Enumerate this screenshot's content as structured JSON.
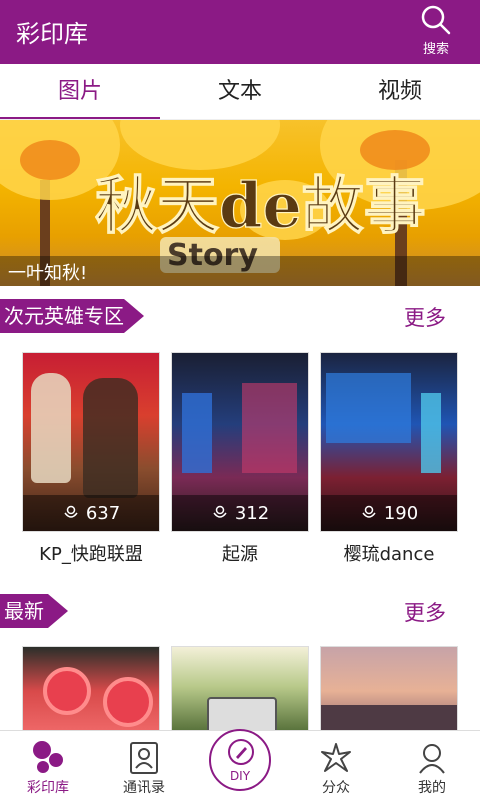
{
  "header": {
    "title": "彩印库",
    "search_label": "搜索"
  },
  "tabs": [
    {
      "label": "图片",
      "active": true
    },
    {
      "label": "文本",
      "active": false
    },
    {
      "label": "视频",
      "active": false
    }
  ],
  "banner": {
    "caption": "一叶知秋!",
    "art_text_main": "秋天de故事",
    "art_text_sub": "Story"
  },
  "section_hot": {
    "title": "次元英雄专区",
    "more": "更多",
    "items": [
      {
        "name": "KP_快跑联盟",
        "count": "637"
      },
      {
        "name": "起源",
        "count": "312"
      },
      {
        "name": "樱琉dance",
        "count": "190"
      }
    ]
  },
  "section_new": {
    "title": "最新",
    "more": "更多"
  },
  "bottom_nav": [
    {
      "label": "彩印库",
      "icon": "dots-icon",
      "active": true
    },
    {
      "label": "通讯录",
      "icon": "contacts-icon",
      "active": false
    },
    {
      "label": "DIY",
      "icon": "pen-icon",
      "active": false
    },
    {
      "label": "分众",
      "icon": "star-burst-icon",
      "active": false
    },
    {
      "label": "我的",
      "icon": "person-icon",
      "active": false
    }
  ],
  "colors": {
    "brand": "#8b1a85"
  }
}
